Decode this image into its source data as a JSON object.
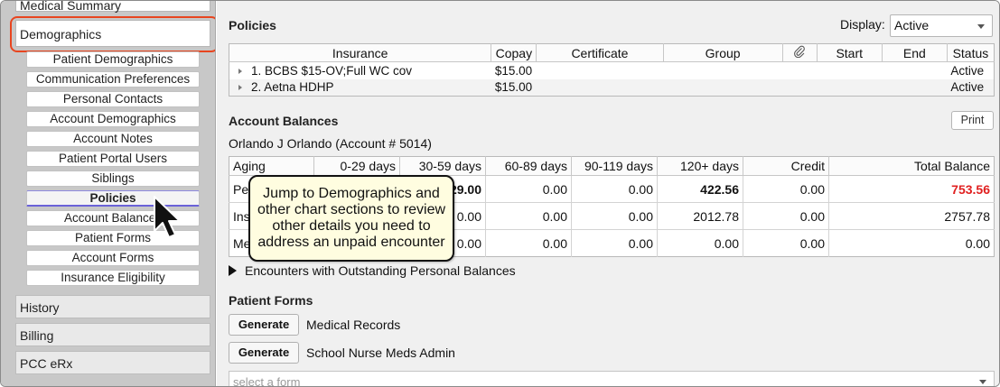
{
  "sidebar": {
    "top_partial": "Medical Summary",
    "demographics": "Demographics",
    "sub_items": [
      "Patient Demographics",
      "Communication Preferences",
      "Personal Contacts",
      "Account Demographics",
      "Account Notes",
      "Patient Portal Users",
      "Siblings",
      "Policies",
      "Account Balances",
      "Patient Forms",
      "Account Forms",
      "Insurance Eligibility"
    ],
    "active_sub_item": "Policies",
    "sections": [
      "History",
      "Billing",
      "PCC eRx"
    ],
    "highlight_color": "#e8451f"
  },
  "policies": {
    "title": "Policies",
    "display_label": "Display:",
    "display_value": "Active",
    "columns": [
      "Insurance",
      "Copay",
      "Certificate",
      "Group",
      "attachment-icon",
      "Start",
      "End",
      "Status"
    ],
    "rows": [
      {
        "insurance": "1. BCBS $15-OV;Full WC cov",
        "copay": "$15.00",
        "certificate": "",
        "group": "",
        "start": "",
        "end": "",
        "status": "Active"
      },
      {
        "insurance": "2. Aetna HDHP",
        "copay": "$15.00",
        "certificate": "",
        "group": "",
        "start": "",
        "end": "",
        "status": "Active"
      }
    ]
  },
  "balances": {
    "title": "Account Balances",
    "print_label": "Print",
    "account_name": "Orlando J Orlando (Account # 5014)",
    "columns": [
      "Aging",
      "0-29 days",
      "30-59 days",
      "60-89 days",
      "90-119 days",
      "120+ days",
      "Credit",
      "Total Balance"
    ],
    "rows": [
      {
        "label": "Pe",
        "c0_29": "",
        "c30_59": "29.00",
        "c60_89": "0.00",
        "c90_119": "0.00",
        "c120": "422.56",
        "credit": "0.00",
        "total": "753.56"
      },
      {
        "label": "Ins",
        "c0_29": "",
        "c30_59": "0.00",
        "c60_89": "0.00",
        "c90_119": "0.00",
        "c120": "2012.78",
        "credit": "0.00",
        "total": "2757.78"
      },
      {
        "label": "Me",
        "c0_29": "",
        "c30_59": "0.00",
        "c60_89": "0.00",
        "c90_119": "0.00",
        "c120": "0.00",
        "credit": "0.00",
        "total": "0.00"
      }
    ],
    "total_alert_color": "#e02020"
  },
  "encounters_label": "Encounters with Outstanding Personal Balances",
  "patient_forms": {
    "title": "Patient Forms",
    "generate_label": "Generate",
    "forms": [
      "Medical Records",
      "School Nurse Meds Admin"
    ],
    "select_placeholder": "select a form"
  },
  "callout": {
    "text": "Jump to Demographics and other chart sections to review other details you need to address an unpaid encounter"
  }
}
